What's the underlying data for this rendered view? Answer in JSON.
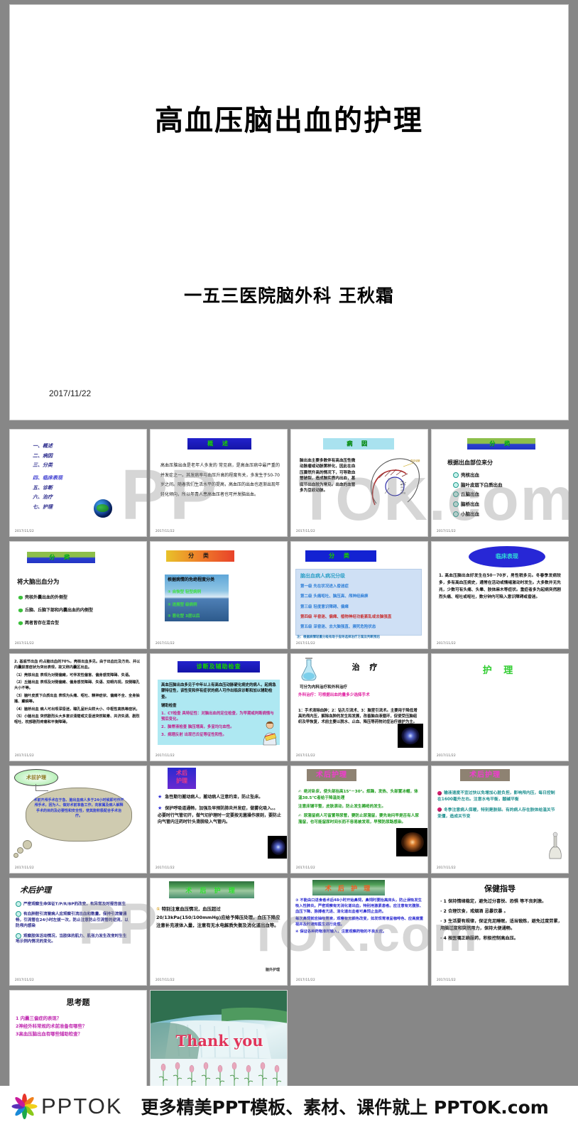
{
  "hero": {
    "title": "高血压脑出血的护理",
    "author": "一五三医院脑外科 王秋霜",
    "date": "2017/11/22"
  },
  "footer": {
    "brand": "PPTOK",
    "tagline": "更多精美PPT模板、素材、课件就上 PPTOK.com",
    "logo_icon": "flower-logo-icon"
  },
  "watermark": {
    "w1": "PP",
    "w2": "TOK.com",
    "w3": "PP",
    "w4": "TOK.com"
  },
  "slides": [
    {
      "n": 1,
      "type": "outline",
      "foot": "2017/11/22",
      "items": [
        "一、概述",
        "二、病因",
        "三、分类",
        "四、临床表现",
        "五、诊断",
        "六、治疗",
        "七、护理"
      ],
      "icon": "globe-icon"
    },
    {
      "n": 2,
      "type": "banner-text",
      "foot": "2017/11/22",
      "banner": "概    述",
      "banner_style": "blue",
      "body": "高血压脑出血是老年人多发的 常见病，是高血压病中最严重的并发症之一。其发病率与血压升高的程度有关，多发生于50-70岁之间。随着我们生活水平的提高，高血压的出血也逐渐出现年轻化倾向，所以年青人患高血压者也可并发脑出血。"
    },
    {
      "n": 3,
      "type": "banner-text-img",
      "foot": "2017/11/22",
      "banner": "病    因",
      "banner_style": "cyan",
      "body": "脑出血主要多数伴有高血压性微动脉瘤或动脉粥样化，因此在血压骤然升高的情况下，可导致血管破裂，造成脑实质内出血，基底节出血较为常见。出血的血管多为豆纹动脉。",
      "img_label": "豆纹动脉",
      "img": "brain-vessel-diagram"
    },
    {
      "n": 4,
      "type": "banner-bullets",
      "foot": "2017/11/22",
      "banner": "分    类",
      "banner_style": "grn-blue",
      "lead": "根据出血部位来分",
      "bullets": [
        "壳核出血",
        "脑叶皮层下白质出血",
        "丘脑出血",
        "脑桥出血",
        "小脑出血"
      ],
      "marker": "circle-number"
    },
    {
      "n": 5,
      "type": "banner-bullets",
      "foot": "2017/11/22",
      "banner": "分    类",
      "banner_style": "grn-blue",
      "lead": "将大脑出血分为",
      "bullets": [
        "壳核外囊出血的外侧型",
        "丘脑、丘脑下部和内囊出血的内侧型",
        "两者皆存在混合型"
      ],
      "marker": "hex"
    },
    {
      "n": 6,
      "type": "banner-image-list",
      "foot": "2017/11/22",
      "banner": "分    类",
      "banner_style": "orange",
      "img_title": "根据病情的危绝程度分类",
      "img_items": [
        "① 自恢型   轻型病例",
        "② 进展型   级病例",
        "③ 恶化型   3层以后"
      ],
      "img": "mountain-lake-photo"
    },
    {
      "n": 7,
      "type": "banner-table",
      "foot": "2017/11/22",
      "banner": "分    类",
      "banner_style": "bluegrn",
      "box_title": "脑出血病人病况分级",
      "rows": [
        "第一级   先在状况进入昏迷症",
        "第二级   头痛呕吐、脑压高、颅神经麻痹",
        "第三级   轻度意识障碍、偏瘫",
        "第四级   半昏迷、偏瘫、植物神经功能紊乱或去脑强直",
        "第五级   深昏迷、去大脑强直、濒死危险状态"
      ],
      "note": "注：根据病情轻重分级有助于指导选择治疗方案及判断预后"
    },
    {
      "n": 8,
      "type": "ellipse-text",
      "foot": "2017/11/22",
      "title": "临床表现",
      "body": "1.  高血压脑出血好发生在50－70岁，男性稍多见。冬春季发病较多，多有高血压病史，通常在活动或情绪激动时发生。大多数并无先兆，少数可有头痛、头晕、肢体麻木等症状。重症者多为起病突然剧烈头痛、呕吐或呕吐，数分钟内可陷入意识障碍或昏迷。"
    },
    {
      "n": 9,
      "type": "plain-text",
      "foot": "2017/11/22",
      "paragraphs": [
        "2. 基底节出血 约占脑出血的70%，壳核出血多见。由于出血灶及方向、并以内囊损害症状为突出表现，故又称内囊区出血。",
        "（1）壳核出血 表现为对侧偏瘫，可伴发性偏盲、偏身感觉障碍、失语。",
        "（2）丘脑出血 表现及对侧偏瘫、偏身感觉障碍、失语、双眼内视，双侧瞳孔大小不等。",
        "（3）脑叶皮质下白质出血 表现为头痛、呕吐、精神症状、偏瘫不全、全身抽搐、癫痫等。",
        "（4）脑桥出血 病人可出现深昏迷，瞳孔呈针尖样大小、中枢性高热等症状。",
        "（5）小脑出血 突然剧烈头大多意识清楚或文昏迷突然眩晕、共济失调、剧烈呕吐、枕部剧烈疼痛和平衡障碍。"
      ]
    },
    {
      "n": 10,
      "type": "banner-box",
      "foot": "2017/11/22",
      "banner": "诊断及辅助检查",
      "banner_style": "blue",
      "box_lines": [
        "高血压脑出血多见于中年以上有高血压动脉硬化病史的病人，起病急骤特征性，该性变和伴有症状的病人可作出临床诊断和加以辅助检查。",
        "辅助检查",
        "1．CT检查 具特征性：对脑出血的定位检查，为早期或判断病情与预后变化。",
        "2．脑脊液检查 脑压增高，多呈均匀血性。",
        "3．病理反射 出现巴氏征等征性阳性。"
      ],
      "img": "doctor-reading-icon"
    },
    {
      "n": 11,
      "type": "treatment",
      "foot": "2017/11/22",
      "title": "治    疗",
      "lines": [
        "可分为内科治疗和外科治疗",
        "外科治疗：可根据出血的量多少选择手术",
        "1：手术清除血肿；2：钻孔引流术、3：脑室引流术。主要用于降低增高的颅内压，解除血肿的发生和发展，改善脑血液循环，促使受压脑组织及早恢复，术前主要以脱水、止血、降压等药物对症治疗维护为主。"
      ],
      "img": "flask-icon",
      "img2": "firework-photo"
    },
    {
      "n": 12,
      "type": "title-only",
      "foot": "2017/11/22",
      "title": "护   理",
      "title_color": "#2ecc2e"
    },
    {
      "n": 13,
      "type": "thought-bubble",
      "foot": "2017/11/22",
      "label": "术前护理",
      "body": "术前开颅手术在于急、脑出血病人多于24小时候即可作开颅手术，因为人、做好术前准备工作，向家属及病人解释手术的目的及必要性和安全性，使其能积极配合手术治疗。"
    },
    {
      "n": 14,
      "type": "banner-star",
      "foot": "2017/11/22",
      "banner_lines": [
        "术后",
        "护理"
      ],
      "banner_style": "blue",
      "items": [
        "急性期勿搬动病人，搬动病人注意约束，防止坠床。",
        "保护呼吸道通畅，加强及早预防肺炎并发症，做雾化吸入。。必要时行气管切开，做气切护理时一定要按无菌操作原则，要防止向气管内注药时针头滑脱吸入气管内。"
      ],
      "img": "firework-photo"
    },
    {
      "n": 15,
      "type": "banner-text2",
      "foot": "2017/11/22",
      "banner": "术后护理",
      "banner_style": "pinkgray",
      "lines": [
        "绝对卧床，使头部抬高15°－30°。烦躁，发热、头部置冰帽，体温38.5℃者给于降温处理",
        "注意床铺平整，皮肤滚动，防止发生褥疮的发生。",
        "尿潴留病人可留置导尿管，要防止尿潴留，要先询问早是否有人尿潴留，也可能留尿时间长而不容易被发现，早预防尿路感染。"
      ],
      "img": "firework-photo-warm"
    },
    {
      "n": 16,
      "type": "banner-dots",
      "foot": "2017/11/22",
      "banner": "术后护理",
      "banner_style": "pinkgray",
      "items": [
        "输液速度不宜过快以免增加心脏负担，影响颅内压，每日控制在1600毫升左右。注意水电平衡，酸碱平衡",
        "冬季注意病人保暖，特别是肢部。有的病人存在肢体给温关节变僵，造成关节变"
      ],
      "img": "lab-equipment-icon"
    },
    {
      "n": 17,
      "type": "title-bullets",
      "foot": "2017/11/22",
      "title": "术后护理",
      "items": [
        "严密观察生命体征T/P/R/BP的改变，有异常及时报告医生",
        "有血肿腔引流管病人应观察引流出血和数量，保持引流管通畅，引流管在24小时左拔一次，防止注意防止引流管的逆流，以防颅内感染",
        "观察肢体活动情况，当肢体的肌力、肌张力发生改变时生生地示例内情况的变化。"
      ],
      "marker": "circle-number"
    },
    {
      "n": 18,
      "type": "banner-green-photo",
      "foot": "2017/11/22",
      "banner": "术 后 护 理",
      "body": "特别注意血压情况，血压超过20/13kPa(150/100mmHg)应给予降压处理，血压下降应注意补充液体入量，注意有无水电解质失衡及消化道出血等。",
      "corner": "脑外护理",
      "img": "landscape-photo"
    },
    {
      "n": 19,
      "type": "banner-green-photo2",
      "foot": "2017/11/22",
      "banner": "术 后 护 理",
      "items": [
        "不能由口进食者术后48小时开始鼻饲，鼻饲时要抬高床头，防止误吸发生吸入性肺炎。严密观察有无消化道出血，特别用激素患者。应注意有无腹胀、血压下降、脉搏者亢进、消化道出血者可鼻饲止血药。",
        "每次鼻饲前应抽吸胃液，观察有无颜色改变，如发现胃液呈咖啡色、应高度重视并及时通知医生进行处理。",
        "保证各种药物准时输入，注意观察药物的不良反应。"
      ],
      "img": "landscape-photo"
    },
    {
      "n": 20,
      "type": "title-list",
      "foot": "2017/11/22",
      "title": "保健指导",
      "items": [
        "1 保持情绪稳定，避免过分喜悦、恐惧 等不良刺激。",
        "2 合理饮食，戒烟酒 忌暴饮暴 。",
        "3 生活要有规律，保证充足睡眠，适当锻炼，避免过度劳累，用脑过度和突然用力，保持大便通畅。",
        "4 按医嘱正确服药，积极控制高血压。"
      ]
    },
    {
      "n": 21,
      "type": "questions",
      "foot": "2017/11/22",
      "title": "思考题",
      "items": [
        "1 内囊三偏症的表现？",
        "2神经外科常规的术前准备有哪些？",
        "3高血压脑出血有哪些辅助检查？"
      ]
    },
    {
      "n": 22,
      "type": "thankyou",
      "foot": "2017/11/22",
      "text": "Thank  you",
      "img": "waterfall-roses-photo"
    }
  ]
}
